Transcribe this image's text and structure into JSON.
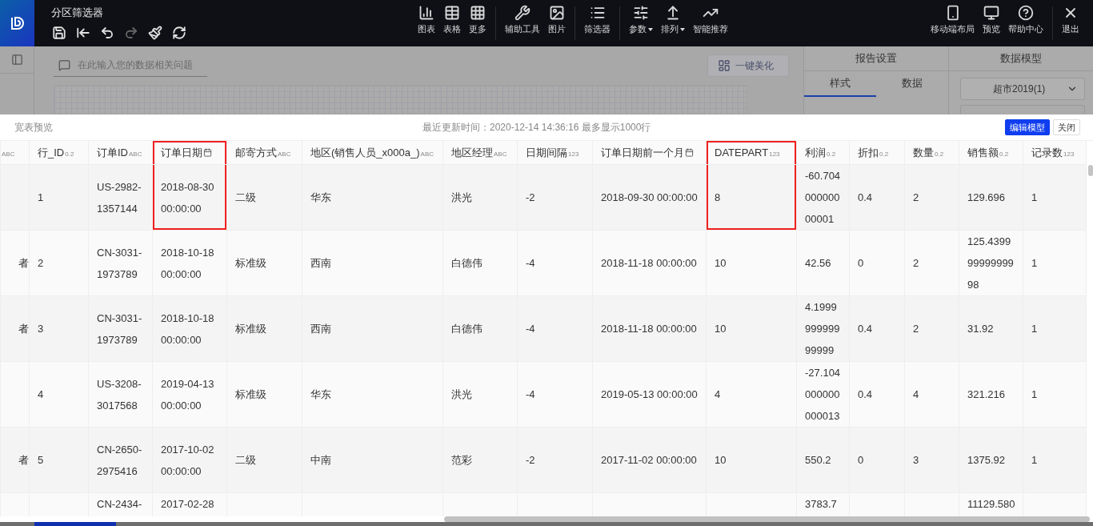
{
  "app": {
    "title": "分区筛选器"
  },
  "quick_actions": [
    {
      "kind": "save",
      "disabled": false
    },
    {
      "kind": "back",
      "disabled": false
    },
    {
      "kind": "undo",
      "disabled": false
    },
    {
      "kind": "redo",
      "disabled": true
    },
    {
      "kind": "brush",
      "disabled": false
    },
    {
      "kind": "refresh",
      "disabled": false
    }
  ],
  "toolbar_groups": [
    [
      {
        "kind": "chart",
        "label": "图表",
        "dropdown": false
      },
      {
        "kind": "table",
        "label": "表格",
        "dropdown": false
      },
      {
        "kind": "more",
        "label": "更多",
        "dropdown": false
      }
    ],
    [
      {
        "kind": "tools",
        "label": "辅助工具",
        "dropdown": false
      },
      {
        "kind": "image",
        "label": "图片",
        "dropdown": false
      }
    ],
    [
      {
        "kind": "filter",
        "label": "筛选器",
        "dropdown": false
      }
    ],
    [
      {
        "kind": "params",
        "label": "参数",
        "dropdown": true
      },
      {
        "kind": "arrange",
        "label": "排列",
        "dropdown": true
      },
      {
        "kind": "recommend",
        "label": "智能推荐",
        "dropdown": false
      }
    ]
  ],
  "right_actions": [
    {
      "kind": "mobile",
      "label": "移动端布局"
    },
    {
      "kind": "preview",
      "label": "预览"
    },
    {
      "kind": "help",
      "label": "帮助中心"
    },
    {
      "kind": "exit",
      "label": "退出"
    }
  ],
  "question_bar": {
    "placeholder": "在此输入您的数据相关问题"
  },
  "beautify_button": "一键美化",
  "report_settings": {
    "title": "报告设置",
    "tabs": [
      {
        "label": "样式",
        "selected": true
      },
      {
        "label": "数据",
        "selected": false
      }
    ]
  },
  "data_model": {
    "title": "数据模型",
    "dataset": "超市2019(1)"
  },
  "preview": {
    "title": "宽表预览",
    "info": "最近更新时间：2020-12-14 14:36:16 最多显示1000行",
    "buttons": [
      {
        "label": "编辑模型",
        "primary": true
      },
      {
        "label": "关闭",
        "primary": false
      }
    ]
  },
  "table": {
    "columns": [
      {
        "badge": "ABC",
        "highlighted": false
      },
      {
        "name": "行_ID",
        "badge": "0.2",
        "highlighted": false
      },
      {
        "name": "订单ID",
        "badge": "ABC",
        "highlighted": false
      },
      {
        "name": "订单日期",
        "kind": "date",
        "highlighted": true
      },
      {
        "name": "邮寄方式",
        "badge": "ABC",
        "highlighted": false
      },
      {
        "name": "地区(销售人员_x000a_)",
        "badge": "ABC",
        "highlighted": false
      },
      {
        "name": "地区经理",
        "badge": "ABC",
        "highlighted": false
      },
      {
        "name": "日期间隔",
        "badge": "123",
        "highlighted": false
      },
      {
        "name": "订单日期前一个月",
        "kind": "date",
        "highlighted": false
      },
      {
        "name": "DATEPART",
        "badge": "123",
        "highlighted": true
      },
      {
        "name": "利润",
        "badge": "0.2",
        "highlighted": false
      },
      {
        "name": "折扣",
        "badge": "0.2",
        "highlighted": false
      },
      {
        "name": "数量",
        "badge": "0.2",
        "highlighted": false
      },
      {
        "name": "销售额",
        "badge": "0.2",
        "highlighted": false
      },
      {
        "name": "记录数",
        "badge": "123",
        "highlighted": false
      }
    ],
    "rows": [
      [
        null,
        "1",
        "US-2982-1357144",
        "2018-08-30 00:00:00",
        "二级",
        "华东",
        "洪光",
        "-2",
        "2018-09-30 00:00:00",
        "8",
        "-60.70400000000001",
        "0.4",
        "2",
        "129.696",
        "1"
      ],
      [
        "者",
        "2",
        "CN-3031-1973789",
        "2018-10-18 00:00:00",
        "标准级",
        "西南",
        "白德伟",
        "-4",
        "2018-11-18 00:00:00",
        "10",
        "42.56",
        "0",
        "2",
        "125.43999999999998",
        "1"
      ],
      [
        "者",
        "3",
        "CN-3031-1973789",
        "2018-10-18 00:00:00",
        "标准级",
        "西南",
        "白德伟",
        "-4",
        "2018-11-18 00:00:00",
        "10",
        "4.199999999999999",
        "0.4",
        "2",
        "31.92",
        "1"
      ],
      [
        null,
        "4",
        "US-3208-3017568",
        "2019-04-13 00:00:00",
        "标准级",
        "华东",
        "洪光",
        "-4",
        "2019-05-13 00:00:00",
        "4",
        "-27.104000000000013",
        "0.4",
        "4",
        "321.216",
        "1"
      ],
      [
        "者",
        "5",
        "CN-2650-2975416",
        "2017-10-02 00:00:00",
        "二级",
        "中南",
        "范彩",
        "-2",
        "2017-11-02 00:00:00",
        "10",
        "550.2",
        "0",
        "3",
        "1375.92",
        "1"
      ],
      [
        null,
        null,
        "CN-2434-",
        "2017-02-28",
        null,
        null,
        null,
        null,
        null,
        null,
        "3783.7",
        null,
        null,
        "11129.580",
        null
      ]
    ]
  }
}
